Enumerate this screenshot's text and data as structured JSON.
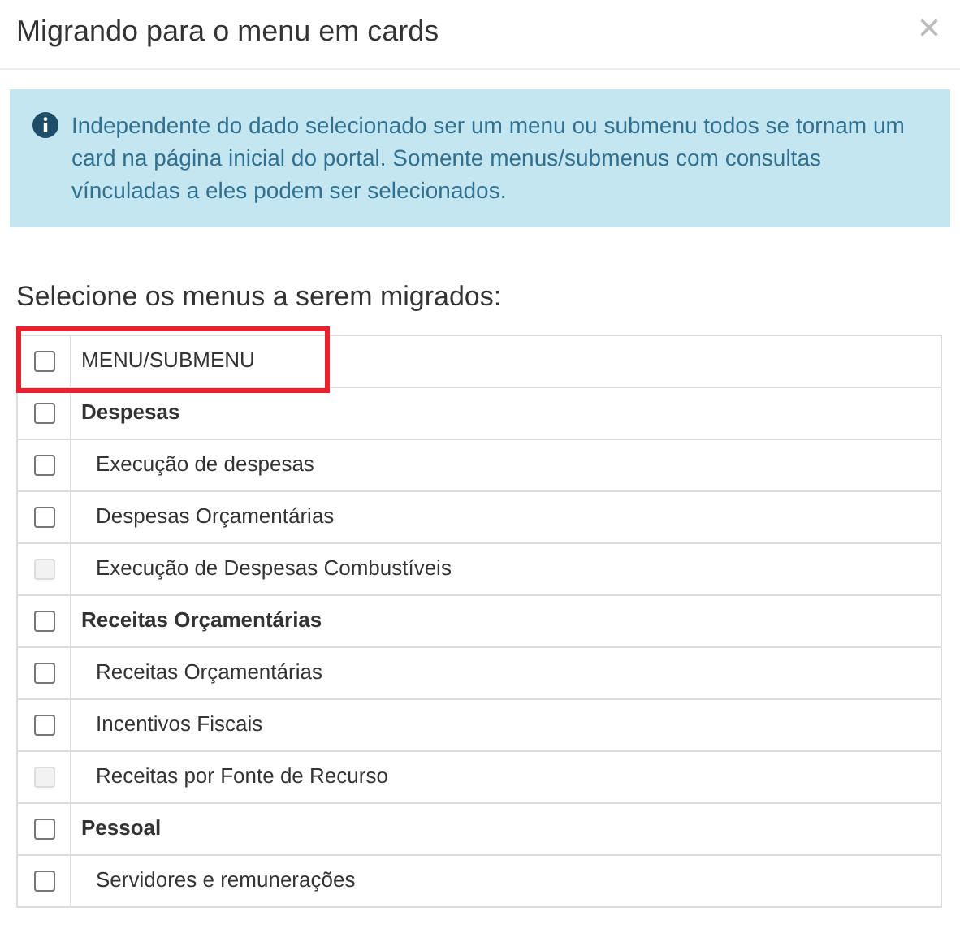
{
  "modal": {
    "title": "Migrando para o menu em cards",
    "close": "×"
  },
  "alert": {
    "text": "Independente do dado selecionado ser um menu ou submenu todos se tornam um card na página inicial do portal. Somente menus/submenus com consultas vínculadas a eles podem ser selecionados."
  },
  "prompt": "Selecione os menus a serem migrados:",
  "table": {
    "header": {
      "label": "MENU/SUBMENU",
      "checked": false,
      "highlighted": true
    },
    "rows": [
      {
        "label": "Despesas",
        "checked": false,
        "disabled": false,
        "children": [
          {
            "label": "Execução de despesas",
            "checked": false,
            "disabled": false
          },
          {
            "label": "Despesas Orçamentárias",
            "checked": false,
            "disabled": false
          },
          {
            "label": "Execução de Despesas Combustíveis",
            "checked": false,
            "disabled": true
          }
        ]
      },
      {
        "label": "Receitas Orçamentárias",
        "checked": false,
        "disabled": false,
        "children": [
          {
            "label": "Receitas Orçamentárias",
            "checked": false,
            "disabled": false
          },
          {
            "label": "Incentivos Fiscais",
            "checked": false,
            "disabled": false
          },
          {
            "label": "Receitas por Fonte de Recurso",
            "checked": false,
            "disabled": true
          }
        ]
      },
      {
        "label": "Pessoal",
        "checked": false,
        "disabled": false,
        "children": [
          {
            "label": "Servidores e remunerações",
            "checked": false,
            "disabled": false
          }
        ]
      }
    ]
  }
}
